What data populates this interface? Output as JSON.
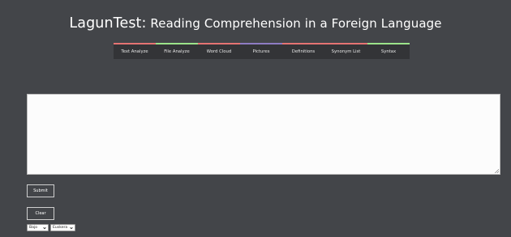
{
  "header": {
    "brand": "LagunTest:",
    "subtitle": "Reading Comprehension in a Foreign Language"
  },
  "nav": {
    "items": [
      {
        "label": "Text Analyze",
        "color": "#e57373"
      },
      {
        "label": "File Analyze",
        "color": "#9be38a"
      },
      {
        "label": "Word Cloud",
        "color": "#e57373"
      },
      {
        "label": "Pictures",
        "color": "#8e7cc3"
      },
      {
        "label": "Definitions",
        "color": "#e57373"
      },
      {
        "label": "Synonym List",
        "color": "#e57373"
      },
      {
        "label": "Syntax",
        "color": "#9be38a"
      }
    ]
  },
  "main": {
    "textarea_value": ""
  },
  "actions": {
    "submit_label": "Submit",
    "clear_label": "Clear"
  },
  "selects": {
    "level": "Bajo",
    "language": "Euskera"
  },
  "icons": {
    "select_chevron": "chevron-down-icon",
    "resize_grip": "resize-grip-icon"
  }
}
